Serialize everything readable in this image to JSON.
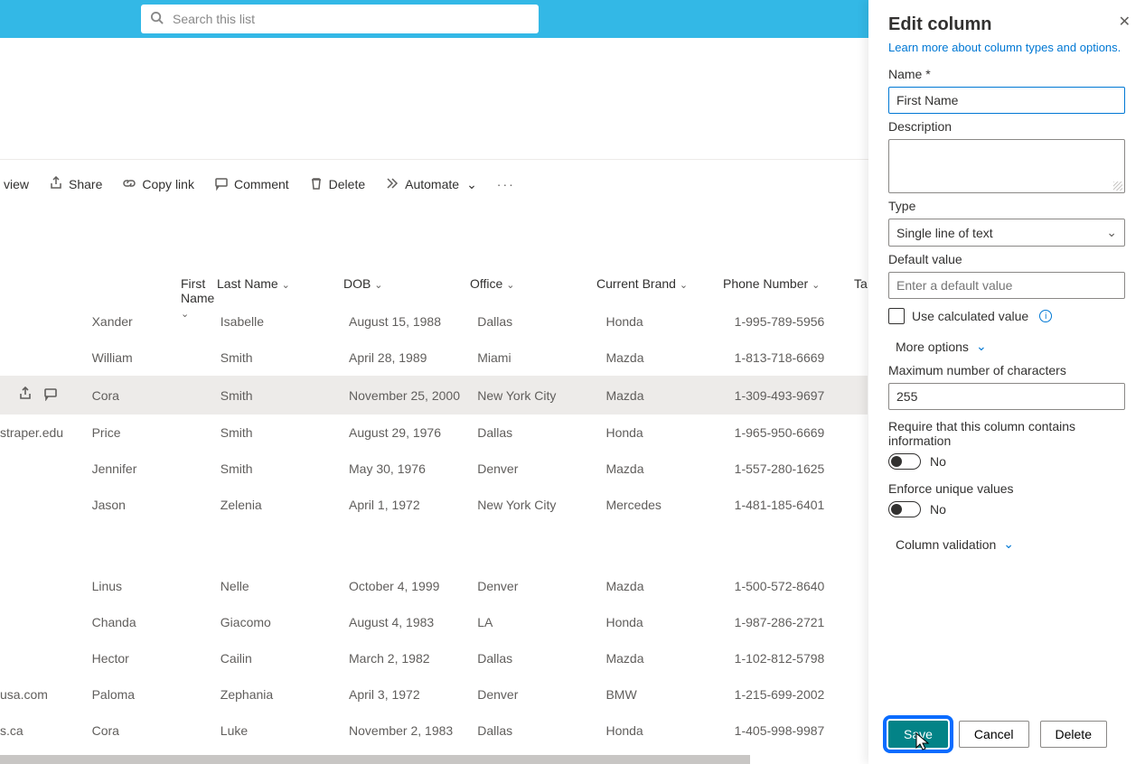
{
  "search": {
    "placeholder": "Search this list"
  },
  "toolbar": {
    "view": "view",
    "share": "Share",
    "copylink": "Copy link",
    "comment": "Comment",
    "delete": "Delete",
    "automate": "Automate"
  },
  "columns": {
    "first": "First Name",
    "last": "Last Name",
    "dob": "DOB",
    "office": "Office",
    "brand": "Current Brand",
    "phone": "Phone Number",
    "tail": "Ta"
  },
  "rows": [
    {
      "lead": "",
      "first": "Xander",
      "last": "Isabelle",
      "dob": "August 15, 1988",
      "office": "Dallas",
      "brand": "Honda",
      "phone": "1-995-789-5956"
    },
    {
      "lead": "",
      "first": "William",
      "last": "Smith",
      "dob": "April 28, 1989",
      "office": "Miami",
      "brand": "Mazda",
      "phone": "1-813-718-6669"
    },
    {
      "lead": "",
      "first": "Cora",
      "last": "Smith",
      "dob": "November 25, 2000",
      "office": "New York City",
      "brand": "Mazda",
      "phone": "1-309-493-9697",
      "selected": true
    },
    {
      "lead": "straper.edu",
      "first": "Price",
      "last": "Smith",
      "dob": "August 29, 1976",
      "office": "Dallas",
      "brand": "Honda",
      "phone": "1-965-950-6669"
    },
    {
      "lead": "",
      "first": "Jennifer",
      "last": "Smith",
      "dob": "May 30, 1976",
      "office": "Denver",
      "brand": "Mazda",
      "phone": "1-557-280-1625"
    },
    {
      "lead": "",
      "first": "Jason",
      "last": "Zelenia",
      "dob": "April 1, 1972",
      "office": "New York City",
      "brand": "Mercedes",
      "phone": "1-481-185-6401"
    }
  ],
  "rows2": [
    {
      "lead": "",
      "first": "Linus",
      "last": "Nelle",
      "dob": "October 4, 1999",
      "office": "Denver",
      "brand": "Mazda",
      "phone": "1-500-572-8640"
    },
    {
      "lead": "",
      "first": "Chanda",
      "last": "Giacomo",
      "dob": "August 4, 1983",
      "office": "LA",
      "brand": "Honda",
      "phone": "1-987-286-2721"
    },
    {
      "lead": "",
      "first": "Hector",
      "last": "Cailin",
      "dob": "March 2, 1982",
      "office": "Dallas",
      "brand": "Mazda",
      "phone": "1-102-812-5798"
    },
    {
      "lead": "usa.com",
      "first": "Paloma",
      "last": "Zephania",
      "dob": "April 3, 1972",
      "office": "Denver",
      "brand": "BMW",
      "phone": "1-215-699-2002"
    },
    {
      "lead": "s.ca",
      "first": "Cora",
      "last": "Luke",
      "dob": "November 2, 1983",
      "office": "Dallas",
      "brand": "Honda",
      "phone": "1-405-998-9987"
    }
  ],
  "panel": {
    "title": "Edit column",
    "learn": "Learn more about column types and options.",
    "name_label": "Name *",
    "name_value": "First Name",
    "desc_label": "Description",
    "type_label": "Type",
    "type_value": "Single line of text",
    "default_label": "Default value",
    "default_placeholder": "Enter a default value",
    "calc_label": "Use calculated value",
    "more_options": "More options",
    "max_label": "Maximum number of characters",
    "max_value": "255",
    "require_label": "Require that this column contains information",
    "no": "No",
    "enforce_label": "Enforce unique values",
    "validation": "Column validation",
    "save": "Save",
    "cancel": "Cancel",
    "delete": "Delete"
  }
}
